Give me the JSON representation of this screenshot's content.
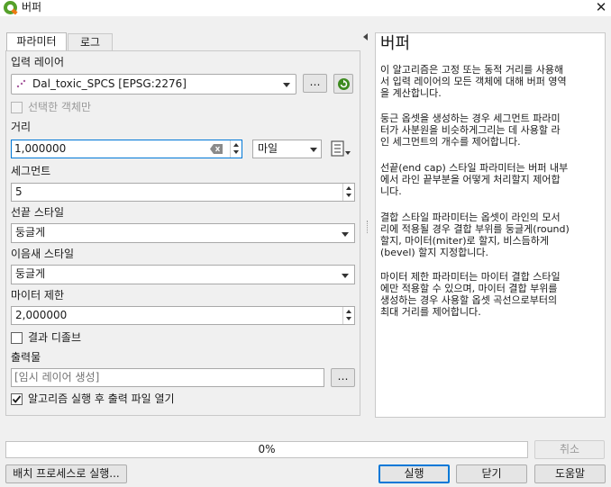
{
  "window": {
    "title": "버퍼",
    "close_glyph": "✕",
    "icon": "qgis-logo"
  },
  "tabs": [
    {
      "label": "파라미터",
      "active": true
    },
    {
      "label": "로그",
      "active": false
    }
  ],
  "params": {
    "input_layer": {
      "label": "입력 레이어",
      "value": "Dal_toxic_SPCS [EPSG:2276]",
      "more_button": "…",
      "selected_only": "선택한 객체만"
    },
    "distance": {
      "label": "거리",
      "value": "1,000000",
      "unit": "마일"
    },
    "segments": {
      "label": "세그먼트",
      "value": "5"
    },
    "end_cap": {
      "label": "선끝 스타일",
      "value": "둥글게"
    },
    "join": {
      "label": "이음새 스타일",
      "value": "둥글게"
    },
    "miter": {
      "label": "마이터 제한",
      "value": "2,000000"
    },
    "dissolve": {
      "label": "결과 디졸브",
      "checked": false
    },
    "output": {
      "label": "출력물",
      "placeholder": "[임시 레이어 생성]",
      "more_button": "…"
    },
    "open_after": {
      "label": "알고리즘 실행 후 출력 파일 열기",
      "checked": true
    }
  },
  "help": {
    "title": "버퍼",
    "paragraphs": [
      [
        "이 알고리즘은 고정 또는 동적 거리를 사용해",
        "서 입력 레이어의 모든 객체에 대해 버퍼 영역",
        "을 계산합니다."
      ],
      [
        "둥근 옵셋을 생성하는 경우 세그먼트 파라미",
        "터가 사분원을 비슷하게그리는 데 사용할 라",
        "인 세그먼트의 개수를 제어합니다."
      ],
      [
        "선끝(end cap) 스타일 파라미터는 버퍼 내부",
        "에서 라인 끝부분을 어떻게 처리할지 제어합",
        "니다."
      ],
      [
        "결합 스타일 파라미터는 옵셋이 라인의 모서",
        "리에 적용될 경우 결합 부위를 둥글게(round)",
        "할지, 마이터(miter)로 할지, 비스듬하게",
        "(bevel) 할지 지정합니다."
      ],
      [
        "마이터 제한 파라미터는 마이터 결합 스타일",
        "에만 적용할 수 있으며, 마이터 결합 부위를",
        "생성하는 경우 사용할 옵셋 곡선으로부터의",
        "최대 거리를 제어합니다."
      ]
    ]
  },
  "bottom": {
    "progress_text": "0%",
    "progress": 0,
    "cancel": "취소",
    "batch": "배치 프로세스로 실행...",
    "run": "실행",
    "close": "닫기",
    "help": "도움말"
  },
  "colors": {
    "accent": "#0078d7",
    "checkmark": "#1a1a1a",
    "refresh_icon": "#3d8a1f"
  }
}
